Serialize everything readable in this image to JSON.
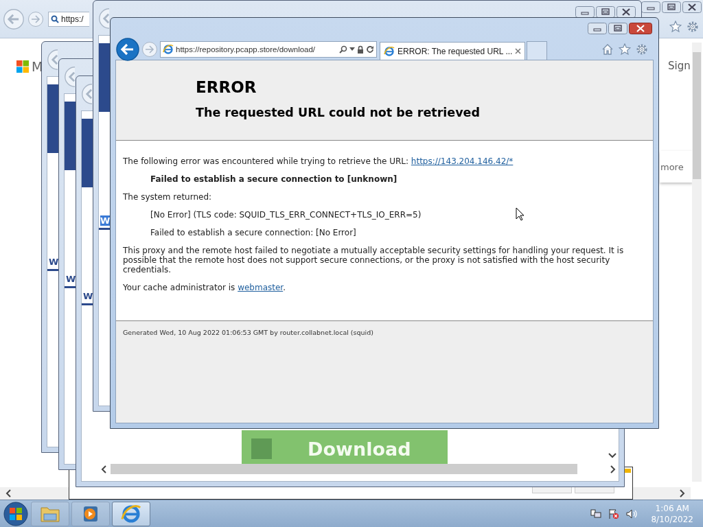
{
  "background_browser": {
    "address": "https:/",
    "logo_text": "M",
    "sign_in": "Sign",
    "more_link": "more"
  },
  "stacked_windows": [
    {
      "fragment": "W",
      "highlighted": false
    },
    {
      "fragment": "W",
      "highlighted": false
    },
    {
      "fragment": "W",
      "highlighted": false,
      "download_button": "Download"
    },
    {
      "fragment": "W",
      "highlighted": true
    }
  ],
  "front_window": {
    "address": "https://repository.pcapp.store/download/",
    "tabs": [
      {
        "label": "ERROR: The requested URL ...",
        "selected": true
      }
    ],
    "page": {
      "title": "ERROR",
      "subtitle": "The requested URL could not be retrieved",
      "intro": "The following error was encountered while trying to retrieve the URL: ",
      "intro_link": "https://143.204.146.42/*",
      "failure": "Failed to establish a secure connection to [unknown]",
      "system_returned": "The system returned:",
      "details": [
        "[No Error] (TLS code: SQUID_TLS_ERR_CONNECT+TLS_IO_ERR=5)",
        "Failed to establish a secure connection: [No Error]"
      ],
      "explanation": "This proxy and the remote host failed to negotiate a mutually acceptable security settings for handling your request. It is possible that the remote host does not support secure connections, or the proxy is not satisfied with the host security credentials.",
      "admin_text": "Your cache administrator is ",
      "admin_link": "webmaster",
      "admin_end": ".",
      "footer": "Generated Wed, 10 Aug 2022 01:06:53 GMT by router.collabnet.local (squid)"
    }
  },
  "taskbar": {
    "apps": [
      {
        "kind": "folder",
        "selected": false
      },
      {
        "kind": "media",
        "selected": false
      },
      {
        "kind": "browser",
        "selected": true
      }
    ],
    "time": "1:06 AM",
    "date": "8/10/2022"
  }
}
